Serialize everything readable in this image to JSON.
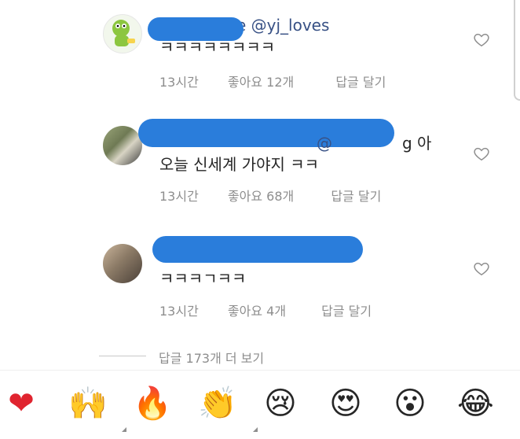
{
  "comments": [
    {
      "handle_fragment": "e @yj_loves",
      "text": "ㅋㅋㅋㅋㅋㅋㅋㅋ",
      "time": "13시간",
      "likes": "좋아요 12개",
      "reply": "답글 달기"
    },
    {
      "handle_fragment": "@",
      "handle_tail": "g 아",
      "text": "오늘 신세계 가야지 ㅋㅋ",
      "time": "13시간",
      "likes": "좋아요 68개",
      "reply": "답글 달기"
    },
    {
      "text": "ㅋㅋㅋㄱㅋㅋ",
      "time": "13시간",
      "likes": "좋아요 4개",
      "reply": "답글 달기"
    }
  ],
  "view_replies": "답글 173개 더 보기",
  "reactions": [
    {
      "name": "red-heart",
      "glyph": "❤"
    },
    {
      "name": "raising-hands",
      "glyph": "🙌"
    },
    {
      "name": "fire",
      "glyph": "🔥"
    },
    {
      "name": "clapping-hands",
      "glyph": "👏"
    },
    {
      "name": "crying-face",
      "glyph": "😢"
    },
    {
      "name": "heart-eyes-face",
      "glyph": "😍"
    },
    {
      "name": "surprised-face",
      "glyph": "😮"
    },
    {
      "name": "tears-of-joy-face",
      "glyph": "😂"
    }
  ],
  "colors": {
    "handle": "#385185",
    "meta": "#8e8e8e",
    "redaction": "#2a7ddb"
  }
}
